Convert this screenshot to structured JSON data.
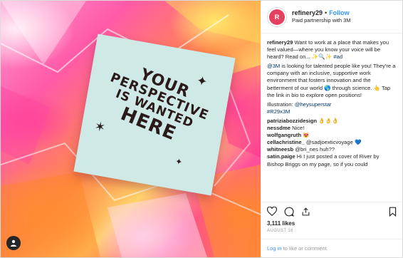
{
  "media": {
    "note_lines": [
      "YOUR",
      "PERSPECTIVE",
      "IS WANTED",
      "HERE"
    ]
  },
  "header": {
    "username": "refinery29",
    "dot": "•",
    "follow_label": "Follow",
    "subtitle": "Paid partnership with 3M"
  },
  "caption": {
    "username": "refinery29",
    "text": "Want to work at a place that makes you feel valued—where you know your voice will be heard? Read on... ✨🔍✨",
    "hashtag": "#ad"
  },
  "body": {
    "mention": "@3M",
    "text": "is looking for talented people like you! They're a company with an inclusive, supportive work environment that fosters innovation and the betterment of our world 🌎 through science. 👆 Tap the link in bio to explore open positions!"
  },
  "credits": {
    "illustration_label": "Illustration:",
    "illustrator": "@heysuperstar",
    "hashtag": "#R29x3M"
  },
  "comments": [
    {
      "user": "patriziabozzidesign",
      "text": "👌👌👌"
    },
    {
      "user": "nessdme",
      "text": "Nice!"
    },
    {
      "user": "wolfgangruth",
      "text": "😻"
    },
    {
      "user": "cellachristine_",
      "text": "@sadjoexticvoyage 💙"
    },
    {
      "user": "whitneesb",
      "text": "@bri_nes huh??"
    },
    {
      "user": "satin.paige",
      "text": "Hi I just posted a cover of River by Bishop Briggs on my page, so if you could"
    }
  ],
  "likes": "3,111 likes",
  "date": "AUGUST 16",
  "login": {
    "link": "Log in",
    "text": "to like or comment."
  },
  "icons": [
    "heart-icon",
    "comment-icon",
    "share-icon",
    "bookmark-icon",
    "user-tag-icon"
  ]
}
